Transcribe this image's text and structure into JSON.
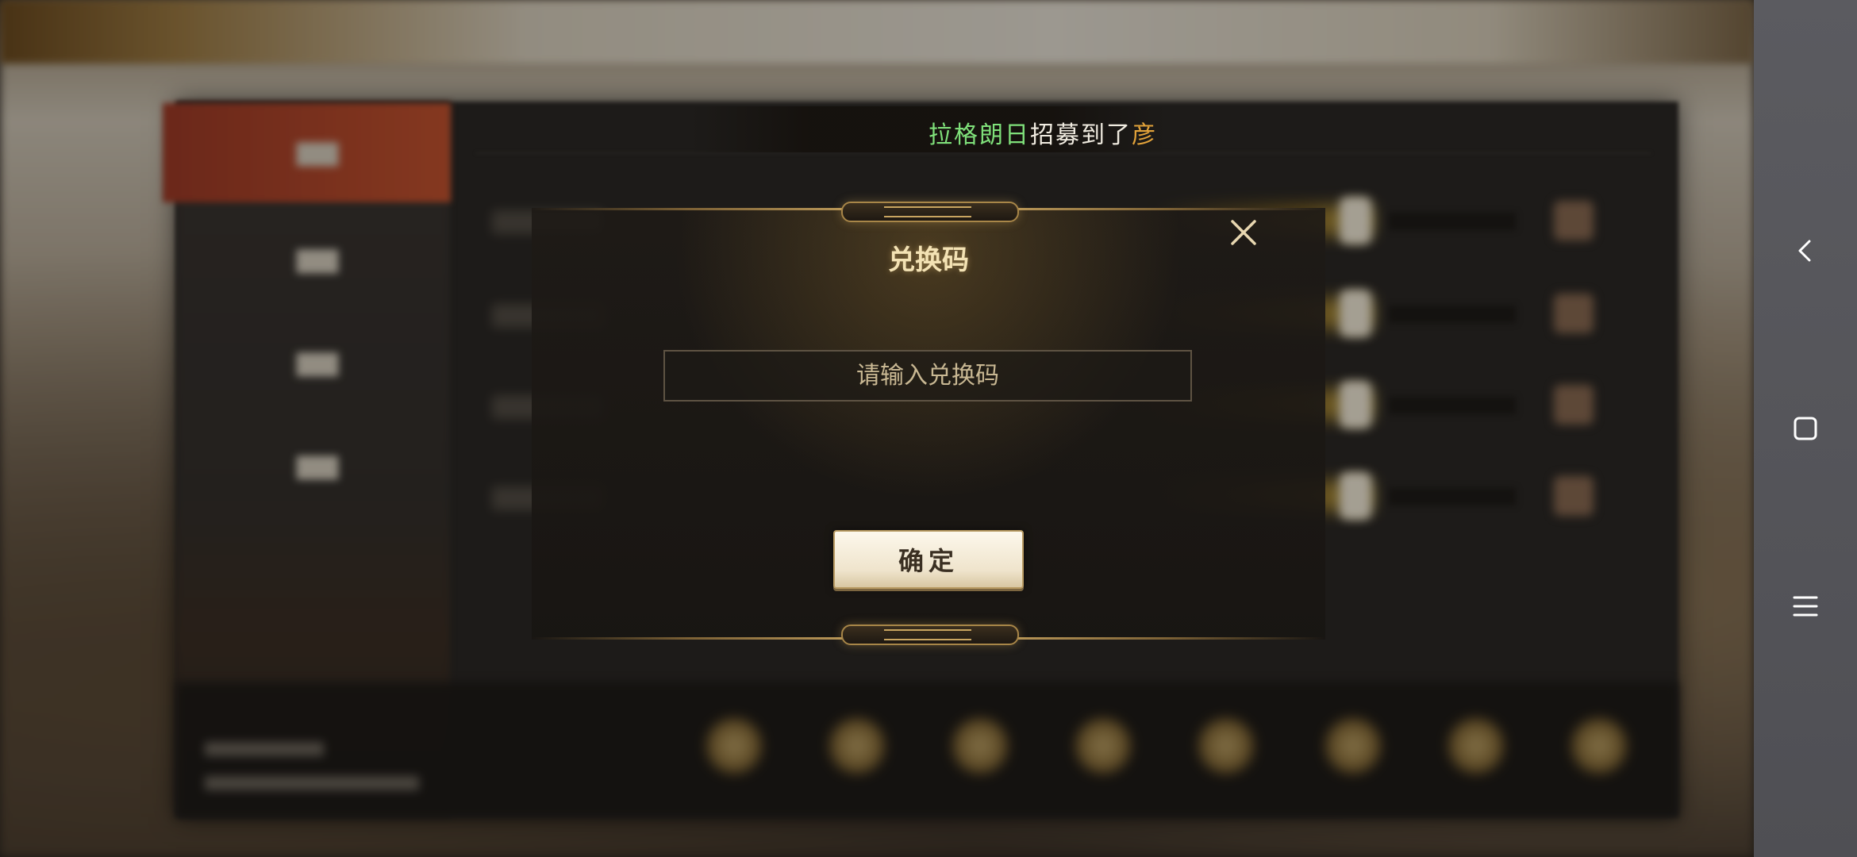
{
  "banner": {
    "name_part1": "拉格朗日",
    "text_part2": "招募到了",
    "name_part3": "彦"
  },
  "dialog": {
    "title": "兑换码",
    "input_placeholder": "请输入兑换码",
    "input_value": "",
    "confirm_label": "确定",
    "close_icon": "close-icon"
  },
  "navbar": {
    "back_icon": "back-icon",
    "home_icon": "home-icon",
    "menu_icon": "menu-icon"
  },
  "colors": {
    "banner_name_green": "#7fe07a",
    "banner_name_orange": "#e3a33a",
    "title_gold": "#f3e2b4",
    "confirm_bg": "#f5ecd8"
  }
}
